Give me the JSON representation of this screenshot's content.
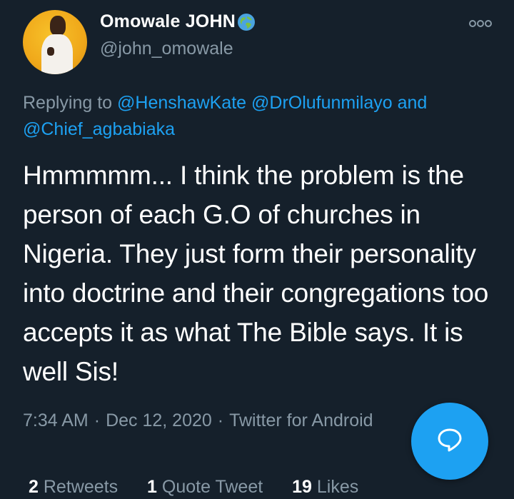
{
  "user": {
    "name": "Omowale JOHN",
    "handle": "@john_omowale"
  },
  "reply": {
    "prefix": "Replying to",
    "mention1": "@HenshawKate",
    "mention2": "@DrOlufunmilayo",
    "conjunction": "and",
    "mention3": "@Chief_agbabiaka"
  },
  "tweet": {
    "text": "Hmmmmm... I think the problem is the person of each G.O of churches in Nigeria. They just form their personality into doctrine and their congregations too accepts it as what The Bible says. It is well Sis!"
  },
  "meta": {
    "time": "7:34 AM",
    "date": "Dec 12, 2020",
    "source": "Twitter for Android",
    "separator": "·"
  },
  "stats": {
    "retweets_count": "2",
    "retweets_label": "Retweets",
    "quotes_count": "1",
    "quotes_label": "Quote Tweet",
    "likes_count": "19",
    "likes_label": "Likes"
  },
  "colors": {
    "background": "#15202b",
    "accent": "#1da1f2",
    "muted": "#8899a6"
  },
  "icons": {
    "verified_badge": "globe-icon",
    "more": "more-icon",
    "compose": "reply-bubble-icon"
  }
}
